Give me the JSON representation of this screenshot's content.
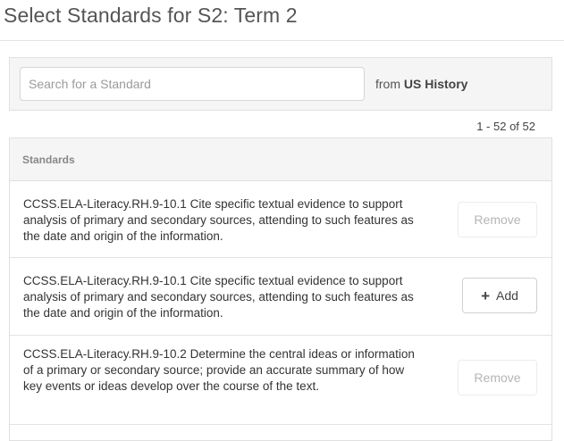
{
  "page": {
    "title": "Select Standards for S2: Term 2"
  },
  "search": {
    "placeholder": "Search for a Standard",
    "value": "",
    "from_prefix": "from",
    "source": "US History"
  },
  "pagination": {
    "text": "1 - 52 of 52"
  },
  "table": {
    "header": "Standards",
    "rows": [
      {
        "text": "CCSS.ELA-Literacy.RH.9-10.1 Cite specific textual evidence to support analysis of primary and secondary sources, attending to such features as the date and origin of the information.",
        "action": "Remove"
      },
      {
        "text": "CCSS.ELA-Literacy.RH.9-10.1 Cite specific textual evidence to support analysis of primary and secondary sources, attending to such features as the date and origin of the information.",
        "action": "Add",
        "action_icon": "plus-icon"
      },
      {
        "text": "CCSS.ELA-Literacy.RH.9-10.2 Determine the central ideas or information of a primary or secondary source; provide an accurate summary of how key events or ideas develop over the course of the text.",
        "action": "Remove"
      }
    ]
  }
}
